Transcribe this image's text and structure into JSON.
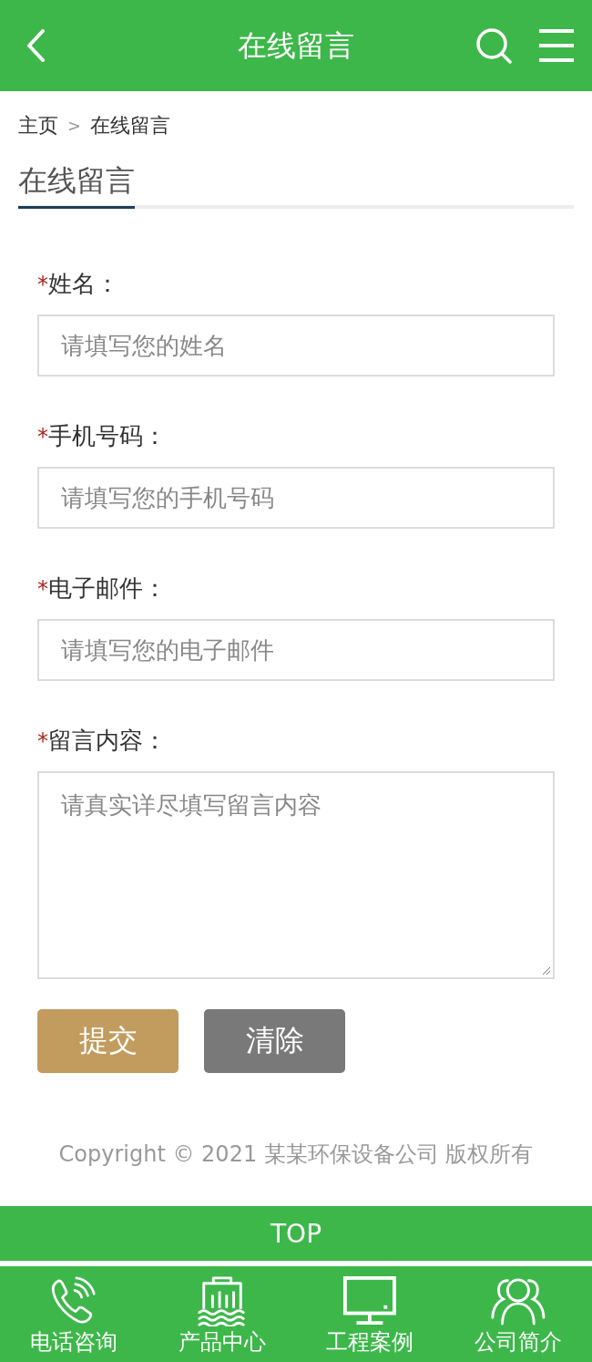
{
  "header": {
    "title": "在线留言"
  },
  "breadcrumb": {
    "items": [
      "主页",
      "在线留言"
    ],
    "separator": ">"
  },
  "section": {
    "title": "在线留言"
  },
  "form": {
    "fields": [
      {
        "kind": "input",
        "required_mark": "*",
        "label": "姓名：",
        "placeholder": "请填写您的姓名"
      },
      {
        "kind": "input",
        "required_mark": "*",
        "label": "手机号码：",
        "placeholder": "请填写您的手机号码"
      },
      {
        "kind": "input",
        "required_mark": "*",
        "label": "电子邮件：",
        "placeholder": "请填写您的电子邮件"
      },
      {
        "kind": "textarea",
        "required_mark": "*",
        "label": "留言内容：",
        "placeholder": "请真实详尽填写留言内容"
      }
    ],
    "buttons": [
      {
        "kind": "submit",
        "label": "提交"
      },
      {
        "kind": "reset",
        "label": "清除"
      }
    ]
  },
  "footer": {
    "copyright": "Copyright © 2021 某某环保设备公司 版权所有"
  },
  "back_to_top": {
    "label": "TOP"
  },
  "bottom_nav": [
    {
      "label": "电话咨询"
    },
    {
      "label": "产品中心"
    },
    {
      "label": "工程案例"
    },
    {
      "label": "公司简介"
    }
  ]
}
